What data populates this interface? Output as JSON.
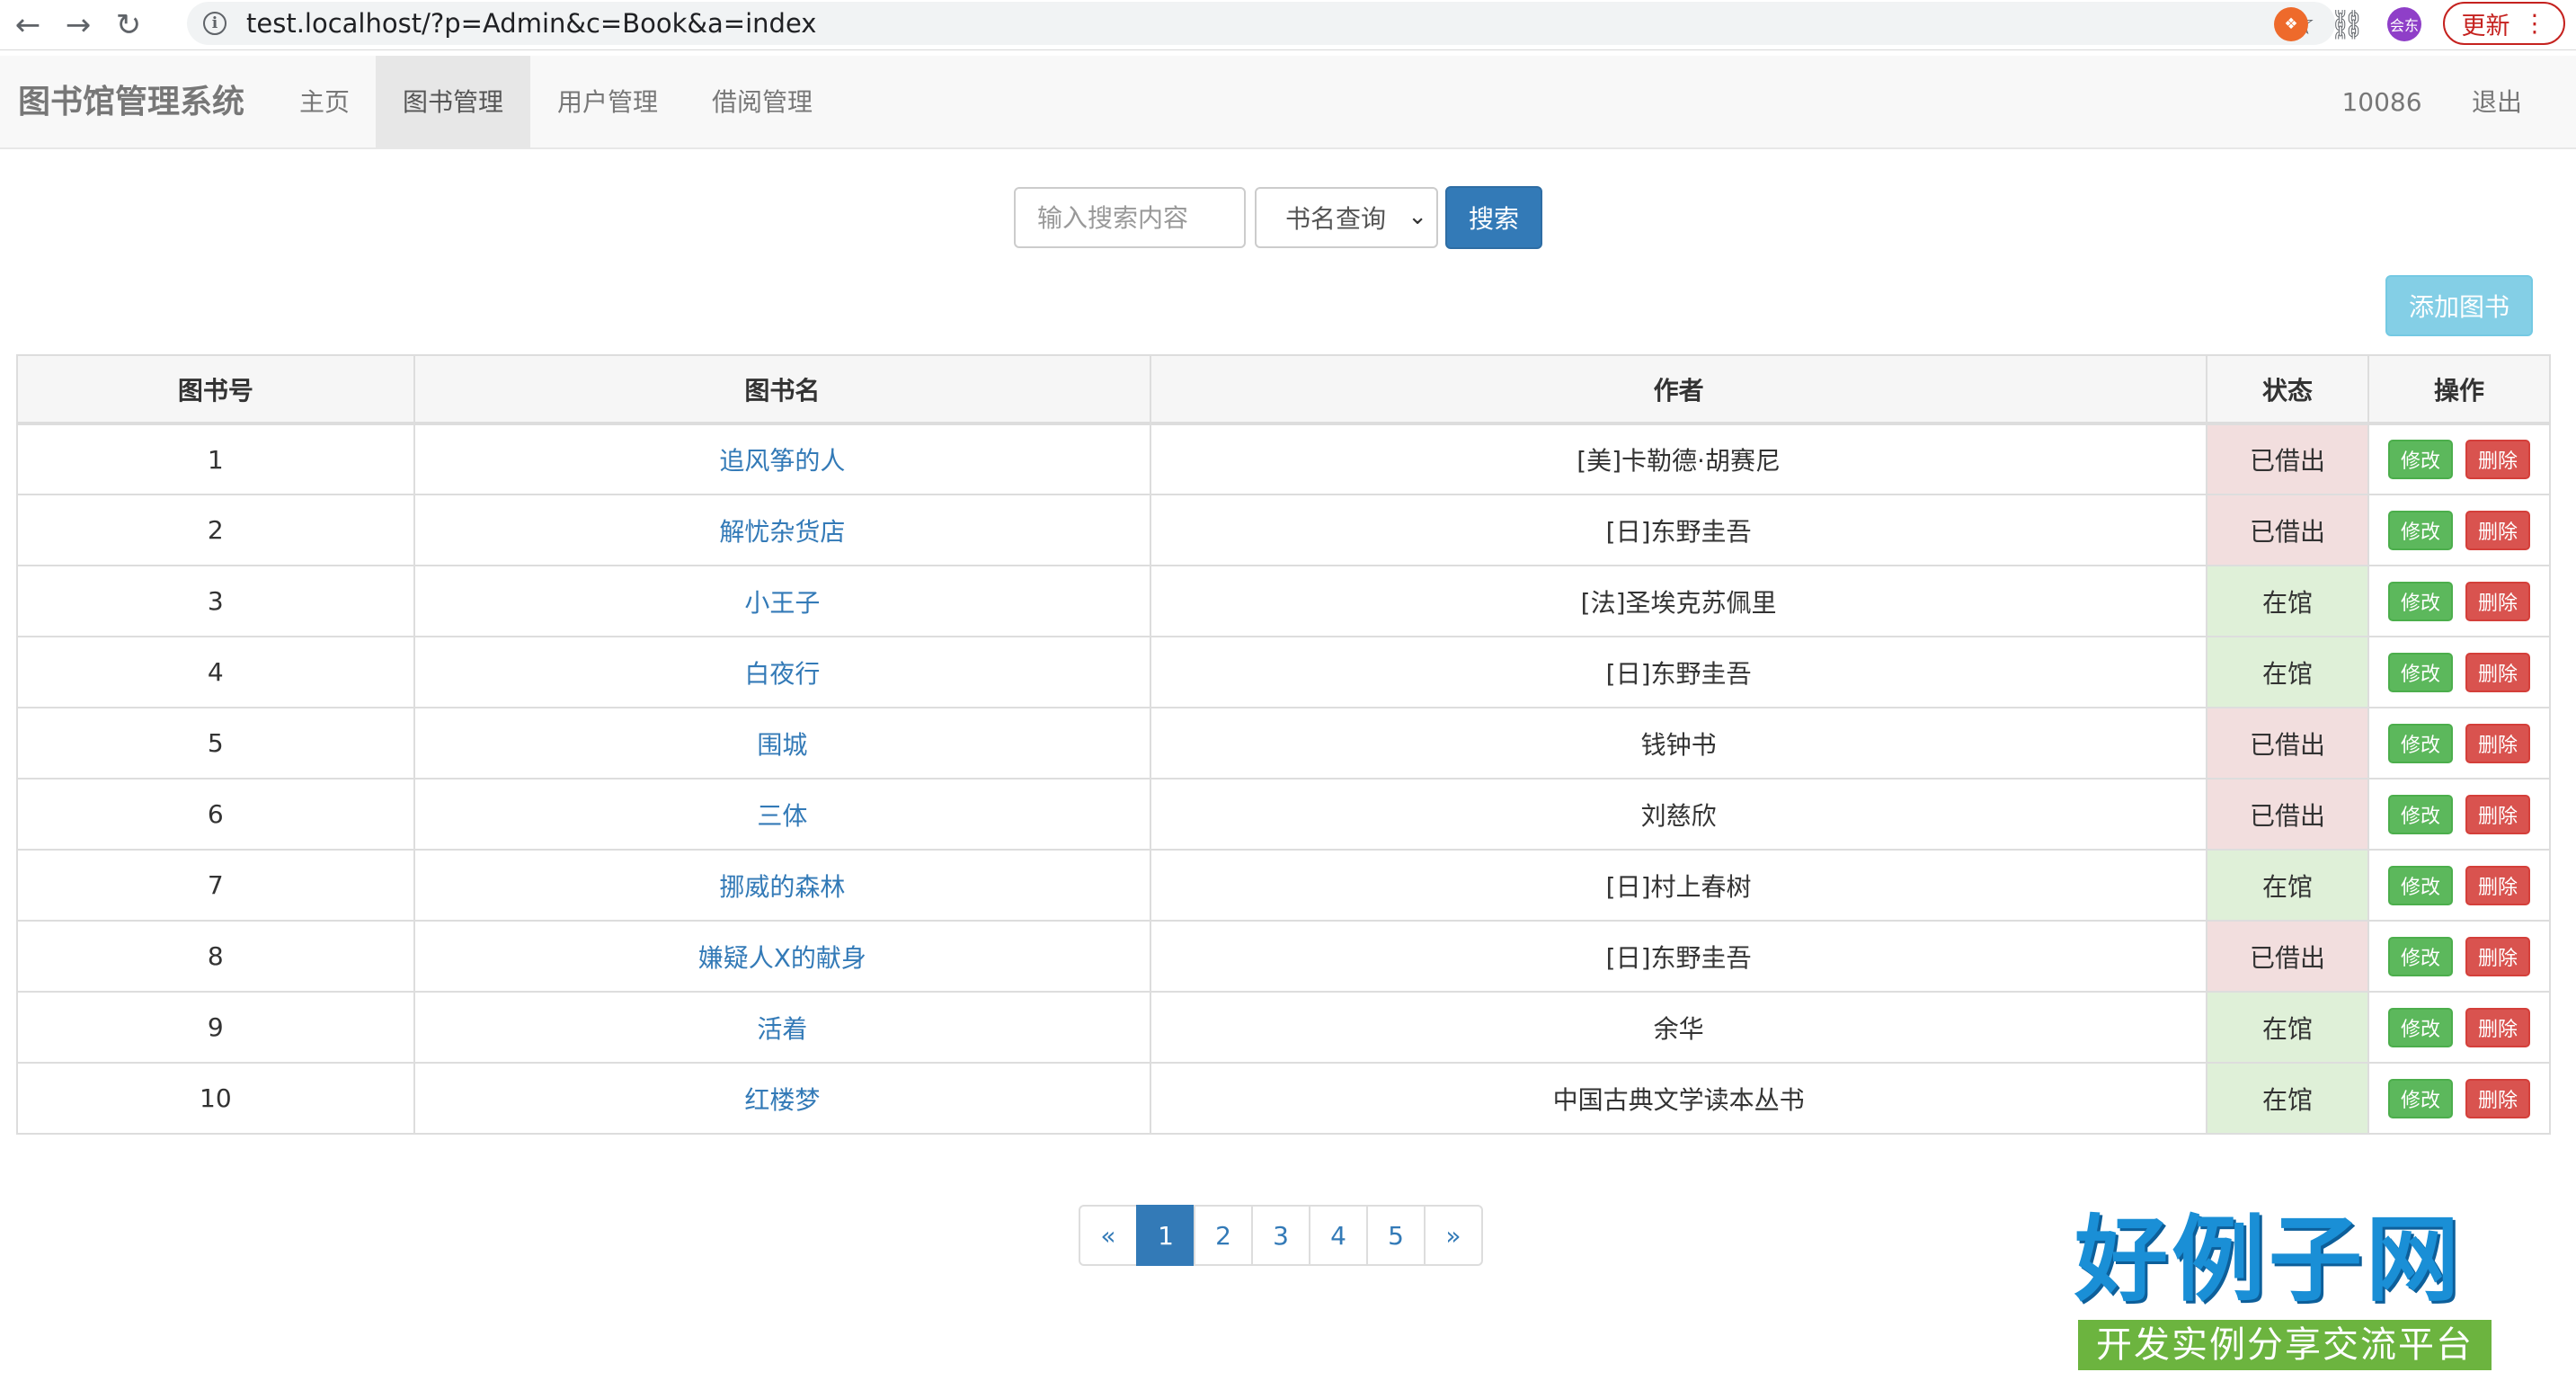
{
  "browser": {
    "url": "test.localhost/?p=Admin&c=Book&a=index",
    "avatar_text": "会东",
    "update_label": "更新"
  },
  "navbar": {
    "brand": "图书馆管理系统",
    "items": [
      {
        "label": "主页"
      },
      {
        "label": "图书管理",
        "active": true
      },
      {
        "label": "用户管理"
      },
      {
        "label": "借阅管理"
      }
    ],
    "user_id": "10086",
    "logout": "退出"
  },
  "search": {
    "placeholder": "输入搜索内容",
    "select_value": "书名查询",
    "button": "搜索"
  },
  "add_button": "添加图书",
  "table": {
    "headers": [
      "图书号",
      "图书名",
      "作者",
      "状态",
      "操作"
    ],
    "edit_label": "修改",
    "delete_label": "删除",
    "rows": [
      {
        "id": "1",
        "name": "追风筝的人",
        "author": "[美]卡勒德·胡赛尼",
        "status": "已借出"
      },
      {
        "id": "2",
        "name": "解忧杂货店",
        "author": "[日]东野圭吾",
        "status": "已借出"
      },
      {
        "id": "3",
        "name": "小王子",
        "author": "[法]圣埃克苏佩里",
        "status": "在馆"
      },
      {
        "id": "4",
        "name": "白夜行",
        "author": "[日]东野圭吾",
        "status": "在馆"
      },
      {
        "id": "5",
        "name": "围城",
        "author": "钱钟书",
        "status": "已借出"
      },
      {
        "id": "6",
        "name": "三体",
        "author": "刘慈欣",
        "status": "已借出"
      },
      {
        "id": "7",
        "name": "挪威的森林",
        "author": "[日]村上春树",
        "status": "在馆"
      },
      {
        "id": "8",
        "name": "嫌疑人X的献身",
        "author": "[日]东野圭吾",
        "status": "已借出"
      },
      {
        "id": "9",
        "name": "活着",
        "author": "余华",
        "status": "在馆"
      },
      {
        "id": "10",
        "name": "红楼梦",
        "author": "中国古典文学读本丛书",
        "status": "在馆"
      }
    ]
  },
  "pagination": {
    "prev": "«",
    "pages": [
      "1",
      "2",
      "3",
      "4",
      "5"
    ],
    "current": "1",
    "next": "»"
  },
  "watermark": {
    "title": "好例子网",
    "subtitle": "开发实例分享交流平台"
  }
}
